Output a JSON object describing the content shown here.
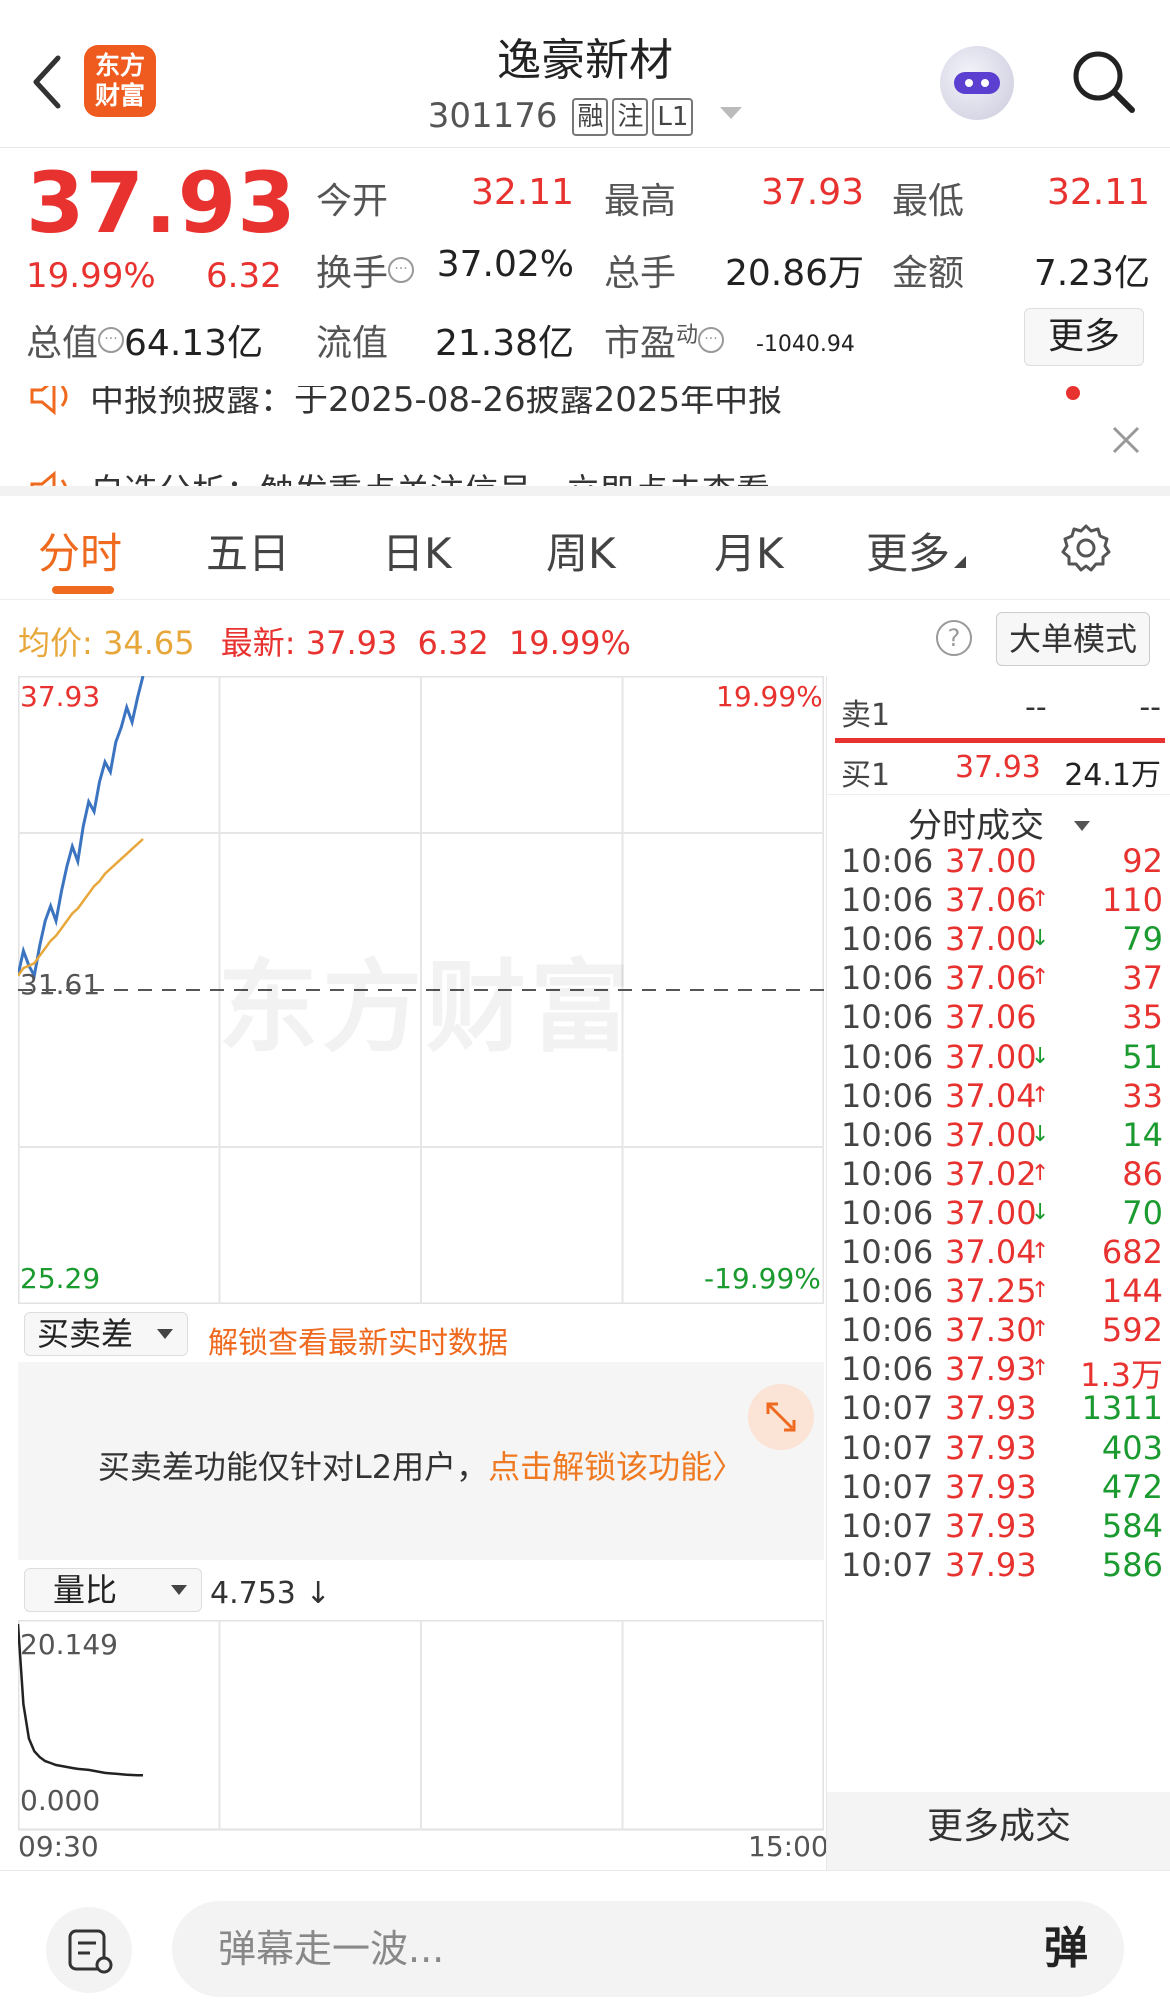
{
  "header": {
    "logo_text_line1": "东方",
    "logo_text_line2": "财富",
    "stock_name": "逸豪新材",
    "stock_code": "301176",
    "tags": [
      "融",
      "注",
      "L1"
    ]
  },
  "quote": {
    "price": "37.93",
    "change_pct": "19.99%",
    "change": "6.32",
    "open_label": "今开",
    "open": "32.11",
    "high_label": "最高",
    "high": "37.93",
    "low_label": "最低",
    "low": "32.11",
    "turnover_label": "换手",
    "turnover": "37.02%",
    "volume_label": "总手",
    "volume": "20.86万",
    "amount_label": "金额",
    "amount": "7.23亿",
    "total_cap_label": "总值",
    "total_cap": "64.13亿",
    "float_cap_label": "流值",
    "float_cap": "21.38亿",
    "pe_label": "市盈",
    "pe_superscript": "动",
    "pe": "-1040.94",
    "more_label": "更多"
  },
  "notices": [
    "中报预披露：于2025-08-26披露2025年中报",
    "自选分析：触发重点关注信号，立即点击查看"
  ],
  "tabs": [
    "分时",
    "五日",
    "日K",
    "周K",
    "月K",
    "更多"
  ],
  "summary": {
    "avg_label": "均价:",
    "avg": "34.65",
    "latest_label": "最新:",
    "latest": "37.93",
    "latest_change": "6.32",
    "latest_pct": "19.99%",
    "help": "?",
    "big_order_label": "大单模式"
  },
  "chart": {
    "watermark": "东方财富",
    "y_max_label": "37.93",
    "y_mid_label": "31.61",
    "y_min_label": "25.29",
    "pct_max_label": "19.99%",
    "pct_min_label": "-19.99%"
  },
  "chart_data": {
    "type": "line",
    "y_range": [
      25.29,
      37.93
    ],
    "baseline": 31.61,
    "x_session": [
      "09:30",
      "15:00"
    ],
    "series": [
      {
        "name": "价格",
        "color": "#3b74c0",
        "values": [
          31.9,
          32.4,
          32.1,
          31.9,
          32.5,
          33.0,
          33.3,
          33.0,
          33.6,
          34.1,
          34.5,
          34.2,
          34.9,
          35.4,
          35.2,
          35.8,
          36.2,
          36.0,
          36.6,
          36.9,
          37.3,
          37.0,
          37.5,
          37.93
        ]
      },
      {
        "name": "均价",
        "color": "#e7a73a",
        "values": [
          31.9,
          32.05,
          32.1,
          32.15,
          32.3,
          32.45,
          32.6,
          32.7,
          32.85,
          33.0,
          33.15,
          33.25,
          33.4,
          33.55,
          33.7,
          33.8,
          33.95,
          34.05,
          34.15,
          34.25,
          34.35,
          34.45,
          34.55,
          34.65
        ]
      }
    ],
    "volume_ratio": {
      "label": "量比",
      "current": "4.753",
      "trend": "↓",
      "y_max_label": "20.149",
      "y_min_label": "0.000",
      "y_range": [
        0,
        20.149
      ],
      "values": [
        20.149,
        12.0,
        8.5,
        7.2,
        6.6,
        6.2,
        6.0,
        5.8,
        5.7,
        5.6,
        5.5,
        5.4,
        5.35,
        5.3,
        5.2,
        5.1,
        5.0,
        4.95,
        4.9,
        4.85,
        4.8,
        4.78,
        4.76,
        4.753
      ]
    }
  },
  "indicator": {
    "name": "买卖差",
    "unlock_hint": "解锁查看最新实时数据",
    "l2_msg_prefix": "买卖差功能仅针对L2用户，",
    "l2_msg_link": "点击解锁该功能〉"
  },
  "time_axis": {
    "start": "09:30",
    "end": "15:00"
  },
  "order_book": {
    "sell1_label": "卖1",
    "sell1_price": "--",
    "sell1_vol": "--",
    "buy1_label": "买1",
    "buy1_price": "37.93",
    "buy1_vol": "24.1万",
    "trades_title": "分时成交",
    "more_trades": "更多成交",
    "trades": [
      {
        "t": "10:06",
        "p": "37.00",
        "a": "",
        "v": "92",
        "c": "red"
      },
      {
        "t": "10:06",
        "p": "37.06",
        "a": "↑",
        "v": "110",
        "c": "red"
      },
      {
        "t": "10:06",
        "p": "37.00",
        "a": "↓",
        "v": "79",
        "c": "green"
      },
      {
        "t": "10:06",
        "p": "37.06",
        "a": "↑",
        "v": "37",
        "c": "red"
      },
      {
        "t": "10:06",
        "p": "37.06",
        "a": "",
        "v": "35",
        "c": "red"
      },
      {
        "t": "10:06",
        "p": "37.00",
        "a": "↓",
        "v": "51",
        "c": "green"
      },
      {
        "t": "10:06",
        "p": "37.04",
        "a": "↑",
        "v": "33",
        "c": "red"
      },
      {
        "t": "10:06",
        "p": "37.00",
        "a": "↓",
        "v": "14",
        "c": "green"
      },
      {
        "t": "10:06",
        "p": "37.02",
        "a": "↑",
        "v": "86",
        "c": "red"
      },
      {
        "t": "10:06",
        "p": "37.00",
        "a": "↓",
        "v": "70",
        "c": "green"
      },
      {
        "t": "10:06",
        "p": "37.04",
        "a": "↑",
        "v": "682",
        "c": "red"
      },
      {
        "t": "10:06",
        "p": "37.25",
        "a": "↑",
        "v": "144",
        "c": "red"
      },
      {
        "t": "10:06",
        "p": "37.30",
        "a": "↑",
        "v": "592",
        "c": "red"
      },
      {
        "t": "10:06",
        "p": "37.93",
        "a": "↑",
        "v": "1.3万",
        "c": "red"
      },
      {
        "t": "10:07",
        "p": "37.93",
        "a": "",
        "v": "1311",
        "c": "green"
      },
      {
        "t": "10:07",
        "p": "37.93",
        "a": "",
        "v": "403",
        "c": "green"
      },
      {
        "t": "10:07",
        "p": "37.93",
        "a": "",
        "v": "472",
        "c": "green"
      },
      {
        "t": "10:07",
        "p": "37.93",
        "a": "",
        "v": "584",
        "c": "green"
      },
      {
        "t": "10:07",
        "p": "37.93",
        "a": "",
        "v": "586",
        "c": "green"
      }
    ]
  },
  "bottom": {
    "danmu_placeholder": "弹幕走一波...",
    "danmu_button": "弹"
  }
}
